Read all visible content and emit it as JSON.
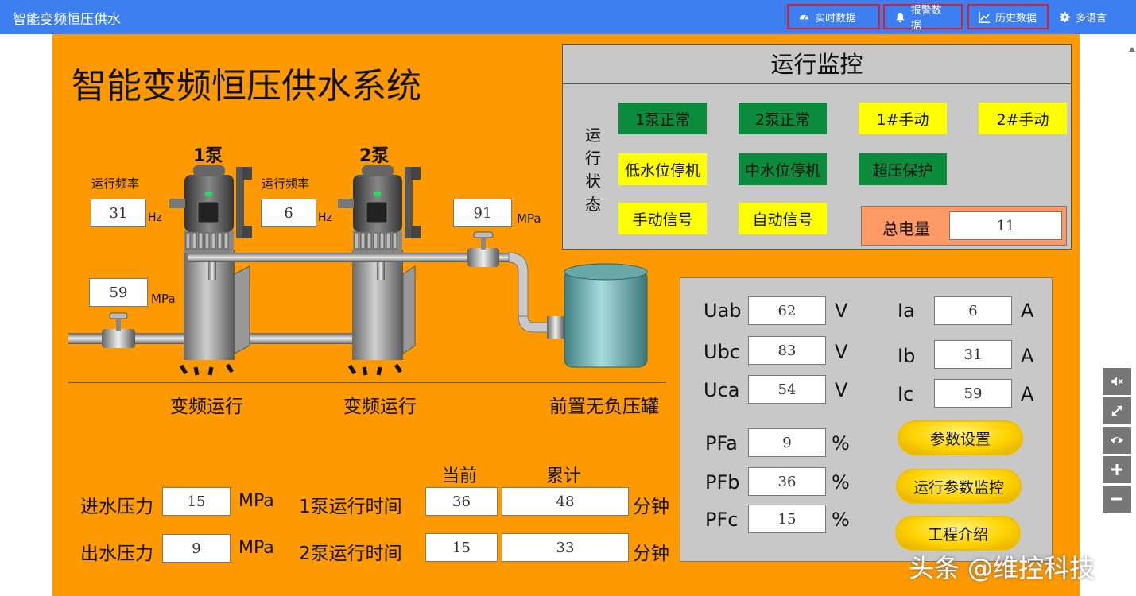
{
  "app": {
    "title": "智能变频恒压供水"
  },
  "nav": {
    "realtime": "实时数据",
    "alarm": "报警数据",
    "history": "历史数据",
    "language": "多语言"
  },
  "page": {
    "title": "智能变频恒压供水系统"
  },
  "pumps": {
    "pump1": {
      "name": "1泵",
      "freq_label": "运行频率",
      "freq": "31",
      "freq_unit": "Hz",
      "status": "变频运行"
    },
    "pump2": {
      "name": "2泵",
      "freq_label": "运行频率",
      "freq": "6",
      "freq_unit": "Hz",
      "status": "变频运行"
    },
    "inlet_pressure": {
      "value": "59",
      "unit": "MPa"
    },
    "outlet_pressure": {
      "value": "91",
      "unit": "MPa"
    },
    "tank_label": "前置无负压罐"
  },
  "monitor": {
    "title": "运行监控",
    "side_label": [
      "运",
      "行",
      "状",
      "态"
    ],
    "chips": {
      "pump1_normal": "1泵正常",
      "pump2_normal": "2泵正常",
      "p1_manual": "1#手动",
      "p2_manual": "2#手动",
      "low_water": "低水位停机",
      "mid_water": "中水位停机",
      "over_pressure": "超压保护",
      "manual_signal": "手动信号",
      "auto_signal": "自动信号"
    },
    "energy_label": "总电量",
    "energy_value": "11"
  },
  "params": {
    "Uab": {
      "label": "Uab",
      "value": "62",
      "unit": "V"
    },
    "Ubc": {
      "label": "Ubc",
      "value": "83",
      "unit": "V"
    },
    "Uca": {
      "label": "Uca",
      "value": "54",
      "unit": "V"
    },
    "Ia": {
      "label": "Ia",
      "value": "6",
      "unit": "A"
    },
    "Ib": {
      "label": "Ib",
      "value": "31",
      "unit": "A"
    },
    "Ic": {
      "label": "Ic",
      "value": "59",
      "unit": "A"
    },
    "PFa": {
      "label": "PFa",
      "value": "9",
      "unit": "%"
    },
    "PFb": {
      "label": "PFb",
      "value": "36",
      "unit": "%"
    },
    "PFc": {
      "label": "PFc",
      "value": "15",
      "unit": "%"
    },
    "btn_settings": "参数设置",
    "btn_monitor": "运行参数监控",
    "btn_intro": "工程介绍"
  },
  "bottom": {
    "current_header": "当前",
    "total_header": "累计",
    "inlet_label": "进水压力",
    "inlet_value": "15",
    "inlet_unit": "MPa",
    "outlet_label": "出水压力",
    "outlet_value": "9",
    "outlet_unit": "MPa",
    "pump1_time_label": "1泵运行时间",
    "pump1_current": "36",
    "pump1_total": "48",
    "pump2_time_label": "2泵运行时间",
    "pump2_current": "15",
    "pump2_total": "33",
    "time_unit": "分钟"
  },
  "watermark": "头条 @维控科技",
  "icons": [
    "dashboard-icon",
    "bell-icon",
    "chart-line-icon",
    "gear-icon",
    "mute-icon",
    "expand-icon",
    "eye-icon",
    "plus-icon",
    "minus-icon"
  ],
  "colors": {
    "topbar": "#3d7ff0",
    "canvas": "#ff9900",
    "green_chip": "#0a8c3c",
    "yellow_chip": "#ffff00",
    "alarm_border": "#e02020"
  }
}
